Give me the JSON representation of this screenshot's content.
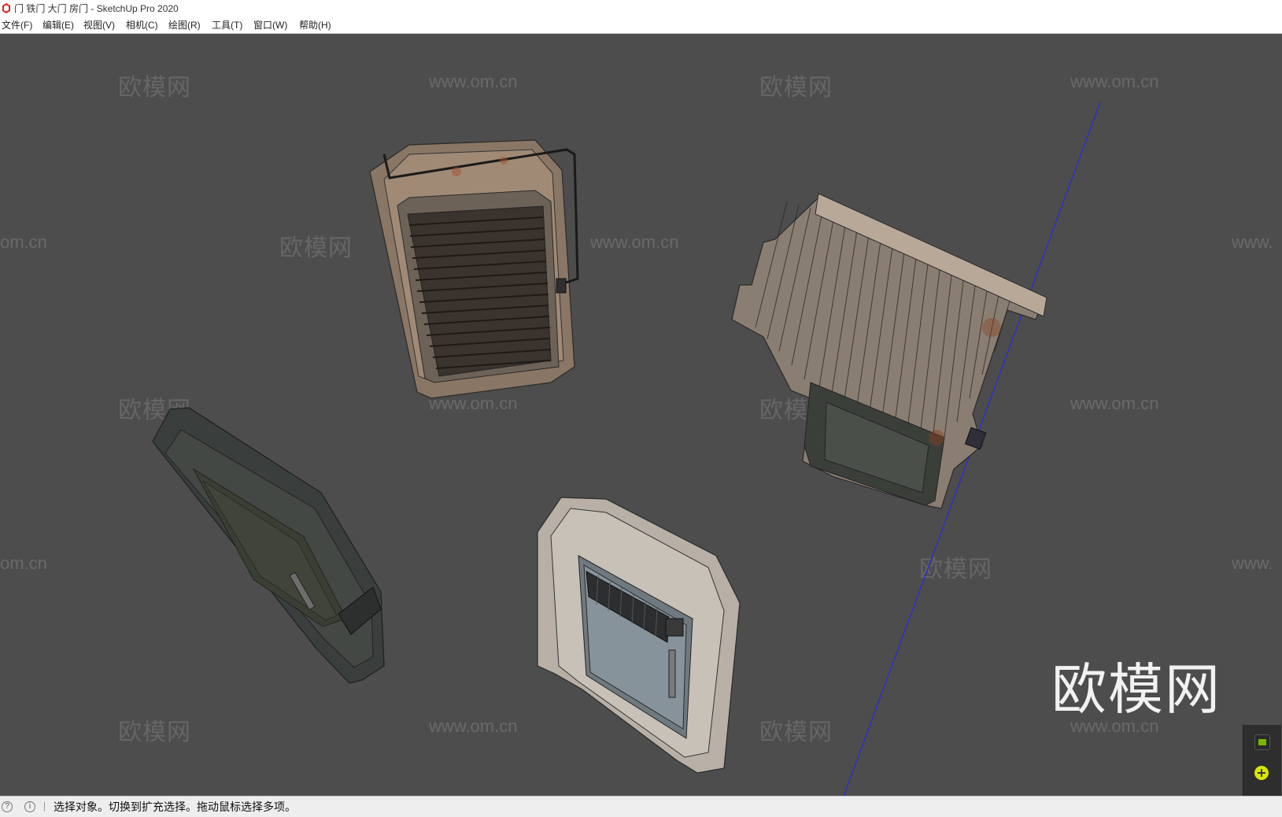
{
  "window": {
    "title": "门 铁门 大门 房门 - SketchUp Pro 2020"
  },
  "menu": [
    {
      "label": "文件(F)"
    },
    {
      "label": "编辑(E)"
    },
    {
      "label": "视图(V)"
    },
    {
      "label": "相机(C)"
    },
    {
      "label": "绘图(R)"
    },
    {
      "label": "工具(T)"
    },
    {
      "label": "窗口(W)"
    },
    {
      "label": "帮助(H)"
    }
  ],
  "watermarks": {
    "cn": "欧模网",
    "url": "www.om.cn",
    "url_partial": "om.cn",
    "url_cut": "www."
  },
  "logo_text": "欧模网",
  "status": {
    "message": "选择对象。切换到扩充选择。拖动鼠标选择多项。"
  },
  "colors": {
    "viewport_bg": "#4d4d4d",
    "axis_blue": "#2b2bd9"
  }
}
